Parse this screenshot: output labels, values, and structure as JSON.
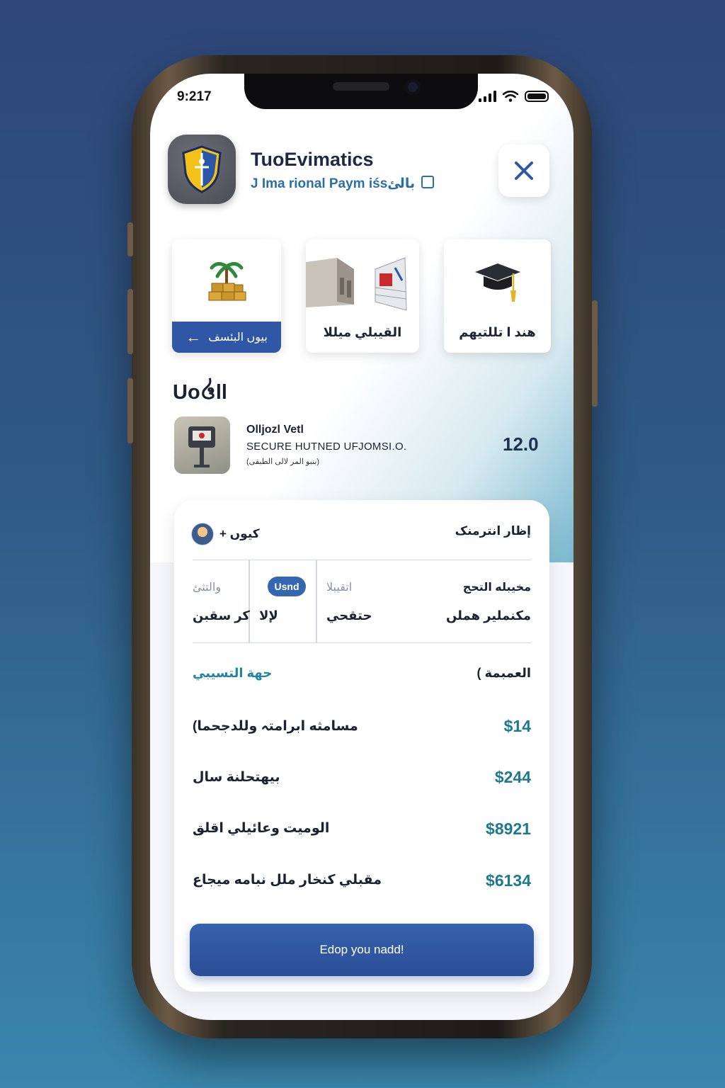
{
  "status_bar": {
    "time": "9:217"
  },
  "header": {
    "title": "TuoEvimatics",
    "subtitle": "J Ima rional Paym iśsبالئ",
    "close_icon": "close-icon"
  },
  "categories": [
    {
      "label": "بیوں البئسف",
      "icon": "treasure-palm-icon",
      "has_action": true
    },
    {
      "label": "القيبلي ميللا",
      "icon": "buildings-icon"
    },
    {
      "label": "هند ا تللتيهم",
      "icon": "graduation-cap-icon"
    }
  ],
  "section": {
    "title": "Uᴏ᪕ll"
  },
  "item": {
    "name": "Olljozl Vetl",
    "description": "SECURE HUTNED UFJOMSI.O.",
    "meta": "(بنبو المر لالى الطبقى)",
    "price": "12.0"
  },
  "panel": {
    "head_left": "كيوں +",
    "head_right": "إظار انترمنک",
    "grid": [
      {
        "top": "والتثئ",
        "bottom": "كر سقبن"
      },
      {
        "top": "Usnd",
        "bottom": "لإلا"
      },
      {
        "top": "اتقيبلا",
        "bottom": "حتقحي"
      },
      {
        "top": "مخيبله التحج",
        "bottom": "مكنملير هملں"
      }
    ],
    "summary_left": "حهة التسيبي",
    "summary_right": "العمبمة )",
    "rows": [
      {
        "label": "مسامثه ابرامتہ وللدجحما)",
        "amount": "$14"
      },
      {
        "label": "بيهتحلنة سال",
        "amount": "$244"
      },
      {
        "label": "الوميت وعائيلي اقلق",
        "amount": "$8921"
      },
      {
        "label": "مقبلي كنخار ملل نبامه ميجاع",
        "amount": "$6134"
      }
    ],
    "cta_label": "Edop you nadd!"
  },
  "colors": {
    "primary": "#2f57a5",
    "accent_teal": "#1d7a8c",
    "text_dark": "#1b2333"
  }
}
